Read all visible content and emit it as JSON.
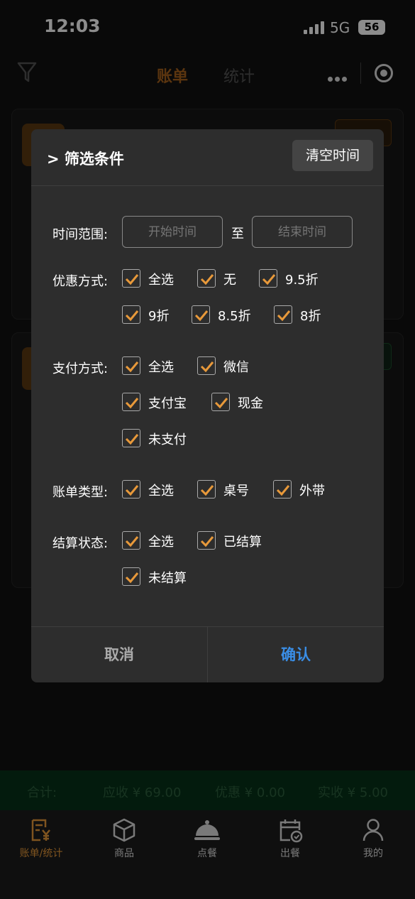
{
  "status_bar": {
    "time": "12:03",
    "network": "5G",
    "battery": "56"
  },
  "header": {
    "tabs": [
      {
        "label": "账单",
        "active": true
      },
      {
        "label": "统计",
        "active": false
      }
    ]
  },
  "filter_modal": {
    "title": "> 筛选条件",
    "clear_time_label": "清空时间",
    "time_range": {
      "label": "时间范围:",
      "start_placeholder": "开始时间",
      "to": "至",
      "end_placeholder": "结束时间"
    },
    "discount": {
      "label": "优惠方式:",
      "options": [
        {
          "label": "全选",
          "checked": true
        },
        {
          "label": "无",
          "checked": true
        },
        {
          "label": "9.5折",
          "checked": true
        },
        {
          "label": "9折",
          "checked": true
        },
        {
          "label": "8.5折",
          "checked": true
        },
        {
          "label": "8折",
          "checked": true
        }
      ]
    },
    "payment": {
      "label": "支付方式:",
      "options": [
        {
          "label": "全选",
          "checked": true
        },
        {
          "label": "微信",
          "checked": true
        },
        {
          "label": "支付宝",
          "checked": true
        },
        {
          "label": "现金",
          "checked": true
        },
        {
          "label": "未支付",
          "checked": true
        }
      ]
    },
    "bill_type": {
      "label": "账单类型:",
      "options": [
        {
          "label": "全选",
          "checked": true
        },
        {
          "label": "桌号",
          "checked": true
        },
        {
          "label": "外带",
          "checked": true
        }
      ]
    },
    "settle_status": {
      "label": "结算状态:",
      "options": [
        {
          "label": "全选",
          "checked": true
        },
        {
          "label": "已结算",
          "checked": true
        },
        {
          "label": "未结算",
          "checked": true
        }
      ]
    },
    "cancel_label": "取消",
    "confirm_label": "确认"
  },
  "totals_bar": {
    "label": "合计:",
    "receivable": "应收 ¥ 69.00",
    "discount": "优惠 ¥ 0.00",
    "actual": "实收 ¥ 5.00"
  },
  "tab_bar": {
    "items": [
      {
        "label": "账单/统计",
        "icon": "bill-icon",
        "active": true
      },
      {
        "label": "商品",
        "icon": "box-icon",
        "active": false
      },
      {
        "label": "点餐",
        "icon": "cloche-icon",
        "active": false
      },
      {
        "label": "出餐",
        "icon": "calendar-check-icon",
        "active": false
      },
      {
        "label": "我的",
        "icon": "user-icon",
        "active": false
      }
    ]
  },
  "colors": {
    "accent": "#e8993a",
    "confirm": "#3a8ee6",
    "modal_bg": "#2d2d2d",
    "totals_bg": "#063218"
  }
}
